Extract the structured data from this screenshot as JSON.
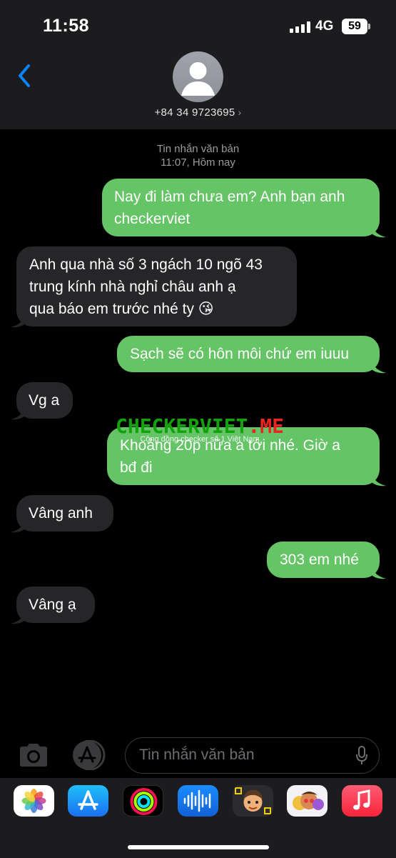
{
  "status": {
    "time": "11:58",
    "network": "4G",
    "battery": "59"
  },
  "contact": {
    "number": "+84 34 9723695",
    "chevron": "›"
  },
  "thread": {
    "type_label": "Tin nhắn văn bản",
    "timestamp": "11:07, Hôm nay"
  },
  "messages": [
    {
      "dir": "out",
      "lines": [
        "Nay đi làm chưa em? Anh bạn anh",
        "checkerviet"
      ]
    },
    {
      "dir": "in",
      "lines": [
        "Anh qua nhà số 3 ngách 10 ngõ 43",
        "trung kính nhà nghỉ châu anh ạ",
        "qua báo em trước nhé ty 😘"
      ]
    },
    {
      "dir": "out",
      "lines": [
        "Sạch sẽ có hôn môi chứ em iuuu"
      ]
    },
    {
      "dir": "in",
      "lines": [
        "Vg a"
      ]
    },
    {
      "dir": "out",
      "lines": [
        "Khoảng 20p nữa a tới nhé. Giờ a",
        "bđ đi"
      ]
    },
    {
      "dir": "in",
      "lines": [
        "Vâng anh"
      ]
    },
    {
      "dir": "out",
      "lines": [
        "303 em nhé"
      ]
    },
    {
      "dir": "in",
      "lines": [
        "Vâng ạ"
      ]
    }
  ],
  "watermark": {
    "part1": "CHECKERVIET",
    "part2": ".ME",
    "subtitle": "Cộng đồng checker số 1 Việt Nam"
  },
  "composer": {
    "placeholder": "Tin nhắn văn bản"
  },
  "colors": {
    "outgoing_bubble": "#65c466",
    "incoming_bubble": "#262628",
    "accent": "#0a84ff"
  },
  "app_strip": [
    "photos-icon",
    "app-store-icon",
    "fitness-icon",
    "voice-memo-icon",
    "memoji-icon",
    "memoji-stickers-icon",
    "music-icon"
  ]
}
